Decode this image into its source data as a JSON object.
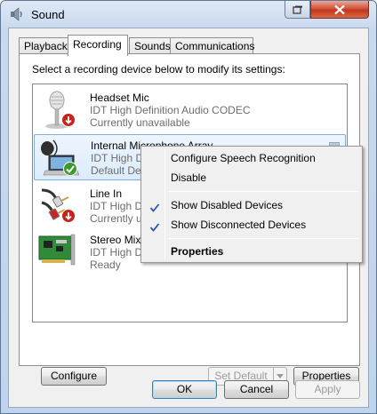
{
  "window": {
    "title": "Sound",
    "icon": "speaker-icon"
  },
  "tabs": [
    {
      "label": "Playback",
      "active": false
    },
    {
      "label": "Recording",
      "active": true
    },
    {
      "label": "Sounds",
      "active": false
    },
    {
      "label": "Communications",
      "active": false
    }
  ],
  "instruction": "Select a recording device below to modify its settings:",
  "devices": [
    {
      "name": "Headset Mic",
      "line2": "IDT High Definition Audio CODEC",
      "line3": "Currently unavailable",
      "icon": "microphone-icon",
      "status_icon": "down-arrow-badge-icon"
    },
    {
      "name": "Internal Microphone Array",
      "line2": "IDT High D",
      "line3": "Default De",
      "icon": "laptop-microphone-icon",
      "status_icon": "checkmark-badge-icon",
      "selected": true
    },
    {
      "name": "Line In",
      "line2": "IDT High D",
      "line3": "Currently u",
      "icon": "rca-cable-icon",
      "status_icon": "down-arrow-badge-icon"
    },
    {
      "name": "Stereo Mix",
      "line2": "IDT High D",
      "line3": "Ready",
      "icon": "sound-card-icon"
    }
  ],
  "context_menu": {
    "items": [
      {
        "label": "Configure Speech Recognition",
        "checked": false
      },
      {
        "label": "Disable",
        "checked": false
      },
      {
        "label": "Show Disabled Devices",
        "checked": true
      },
      {
        "label": "Show Disconnected Devices",
        "checked": true
      },
      {
        "label": "Properties",
        "checked": false,
        "bold": true
      }
    ]
  },
  "panel_buttons": {
    "configure": "Configure",
    "set_default": "Set Default",
    "properties": "Properties"
  },
  "dialog_buttons": {
    "ok": "OK",
    "cancel": "Cancel",
    "apply": "Apply"
  },
  "colors": {
    "selection": "#dcebfc",
    "check": "#2a57a6",
    "close_button": "#c4351a"
  }
}
